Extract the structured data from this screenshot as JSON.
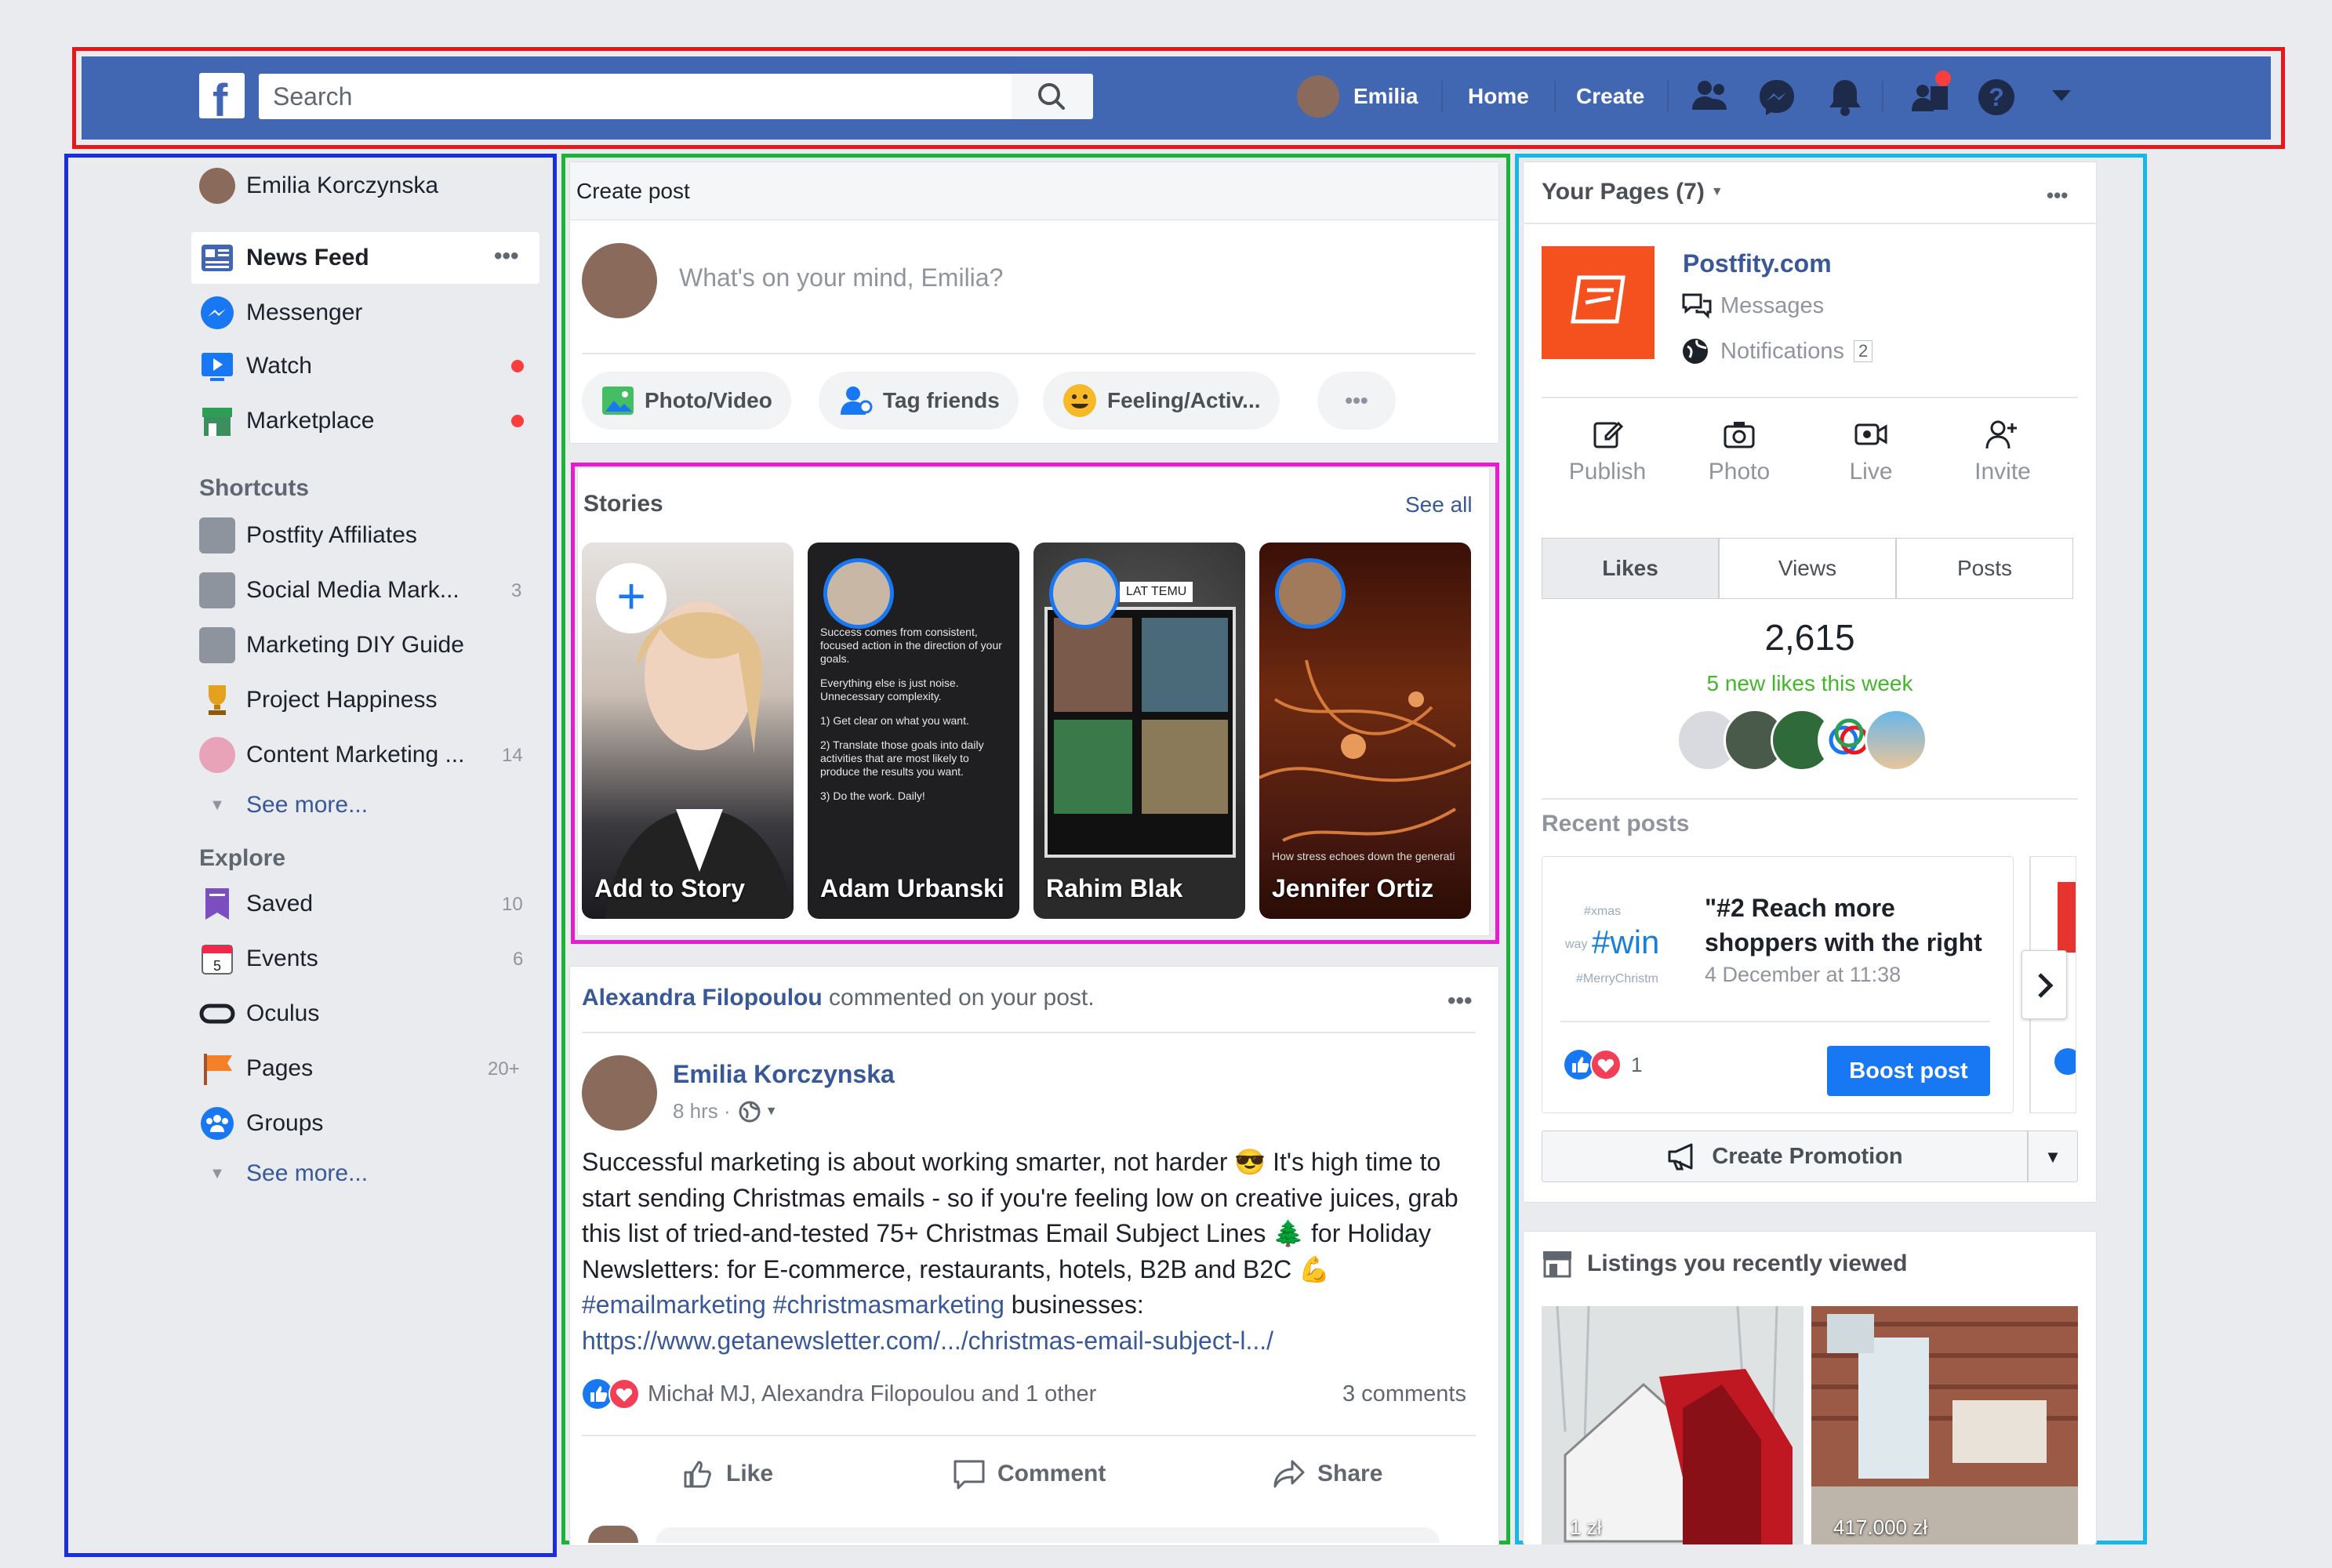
{
  "topbar": {
    "search_placeholder": "Search",
    "profile_name": "Emilia",
    "home": "Home",
    "create": "Create"
  },
  "sidebar": {
    "profile": "Emilia Korczynska",
    "main": [
      {
        "label": "News Feed"
      },
      {
        "label": "Messenger"
      },
      {
        "label": "Watch"
      },
      {
        "label": "Marketplace"
      }
    ],
    "shortcuts_title": "Shortcuts",
    "shortcuts": [
      {
        "label": "Postfity Affiliates",
        "count": ""
      },
      {
        "label": "Social Media Mark...",
        "count": "3"
      },
      {
        "label": "Marketing DIY Guide",
        "count": ""
      },
      {
        "label": "Project Happiness",
        "count": ""
      },
      {
        "label": "Content Marketing ...",
        "count": "14"
      }
    ],
    "see_more": "See more...",
    "explore_title": "Explore",
    "explore": [
      {
        "label": "Saved",
        "count": "10"
      },
      {
        "label": "Events",
        "count": "6"
      },
      {
        "label": "Oculus",
        "count": ""
      },
      {
        "label": "Pages",
        "count": "20+"
      },
      {
        "label": "Groups",
        "count": ""
      }
    ],
    "see_more2": "See more..."
  },
  "create_post": {
    "title": "Create post",
    "placeholder": "What's on your mind, Emilia?",
    "photo": "Photo/Video",
    "tag": "Tag friends",
    "feeling": "Feeling/Activ..."
  },
  "stories": {
    "title": "Stories",
    "see_all": "See all",
    "items": [
      {
        "name": "Add to Story"
      },
      {
        "name": "Adam Urbanski"
      },
      {
        "name": "Rahim Blak"
      },
      {
        "name": "Jennifer Ortiz"
      }
    ],
    "adam_text": [
      "Success comes from consistent, focused action in the direction of your goals.",
      "Everything else is just noise. Unnecessary complexity.",
      "1) Get clear on what you want.",
      "2) Translate those goals into daily activities that are most likely to produce the results you want.",
      "3) Do the work. Daily!"
    ],
    "rahim_badge": "LAT TEMU",
    "jennifer_caption": "How stress echoes down the generati"
  },
  "post": {
    "commenter": "Alexandra Filopoulou",
    "commented_text": "commented on your post.",
    "author": "Emilia Korczynska",
    "time": "8 hrs ·",
    "body": "Successful marketing is about working smarter, not harder 😎 It's high time to start sending Christmas emails - so if you're feeling low on creative juices, grab this list of tried-and-tested 75+ Christmas Email Subject Lines 🌲 for Holiday Newsletters: for E-commerce, restaurants, hotels, B2B and B2C 💪",
    "hashtags": "#emailmarketing #christmasmarketing",
    "body_end": " businesses:",
    "link": "https://www.getanewsletter.com/.../christmas-email-subject-l.../",
    "reactions": "Michał MJ, Alexandra Filopoulou and 1 other",
    "comments": "3 comments",
    "like": "Like",
    "comment": "Comment",
    "share": "Share"
  },
  "pages": {
    "title": "Your Pages (7)",
    "page_name": "Postfity.com",
    "messages": "Messages",
    "notifications": "Notifications",
    "notif_count": "2",
    "actions": [
      {
        "label": "Publish"
      },
      {
        "label": "Photo"
      },
      {
        "label": "Live"
      },
      {
        "label": "Invite"
      }
    ],
    "tabs": [
      {
        "label": "Likes"
      },
      {
        "label": "Views"
      },
      {
        "label": "Posts"
      }
    ],
    "likes_count": "2,615",
    "new_likes": "5 new likes this week",
    "recent_title": "Recent posts",
    "recent_post_title": "\"#2 Reach more shoppers with the right",
    "recent_post_date": "4 December at 11:38",
    "recent_reactions": "1",
    "boost": "Boost post",
    "create_promotion": "Create Promotion",
    "thumb_text": [
      "#xmas",
      "#win",
      "#MerryChristm",
      "way"
    ]
  },
  "listings": {
    "title": "Listings you recently viewed",
    "items": [
      {
        "price": "1 zł"
      },
      {
        "price": "417.000 zł"
      }
    ]
  },
  "colors": {
    "fb_blue": "#4267b2",
    "link": "#385898",
    "green": "#42b72a",
    "red_dot": "#fa3e3e"
  }
}
